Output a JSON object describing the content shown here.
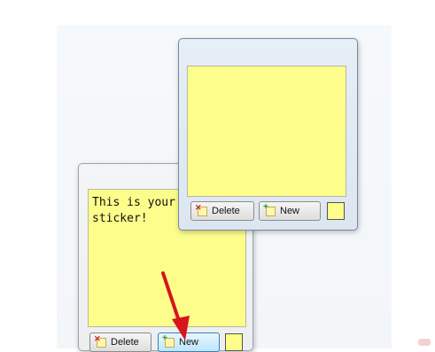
{
  "back_note": {
    "text": "This is your\nsticker!",
    "delete_label": "Delete",
    "new_label": "New"
  },
  "front_note": {
    "text": "",
    "delete_label": "Delete",
    "new_label": "New"
  },
  "colors": {
    "note_yellow": "#fdfd8b",
    "arrow_red": "#d9141b"
  },
  "icons": {
    "delete": "delete-note-icon",
    "new": "new-note-icon"
  }
}
